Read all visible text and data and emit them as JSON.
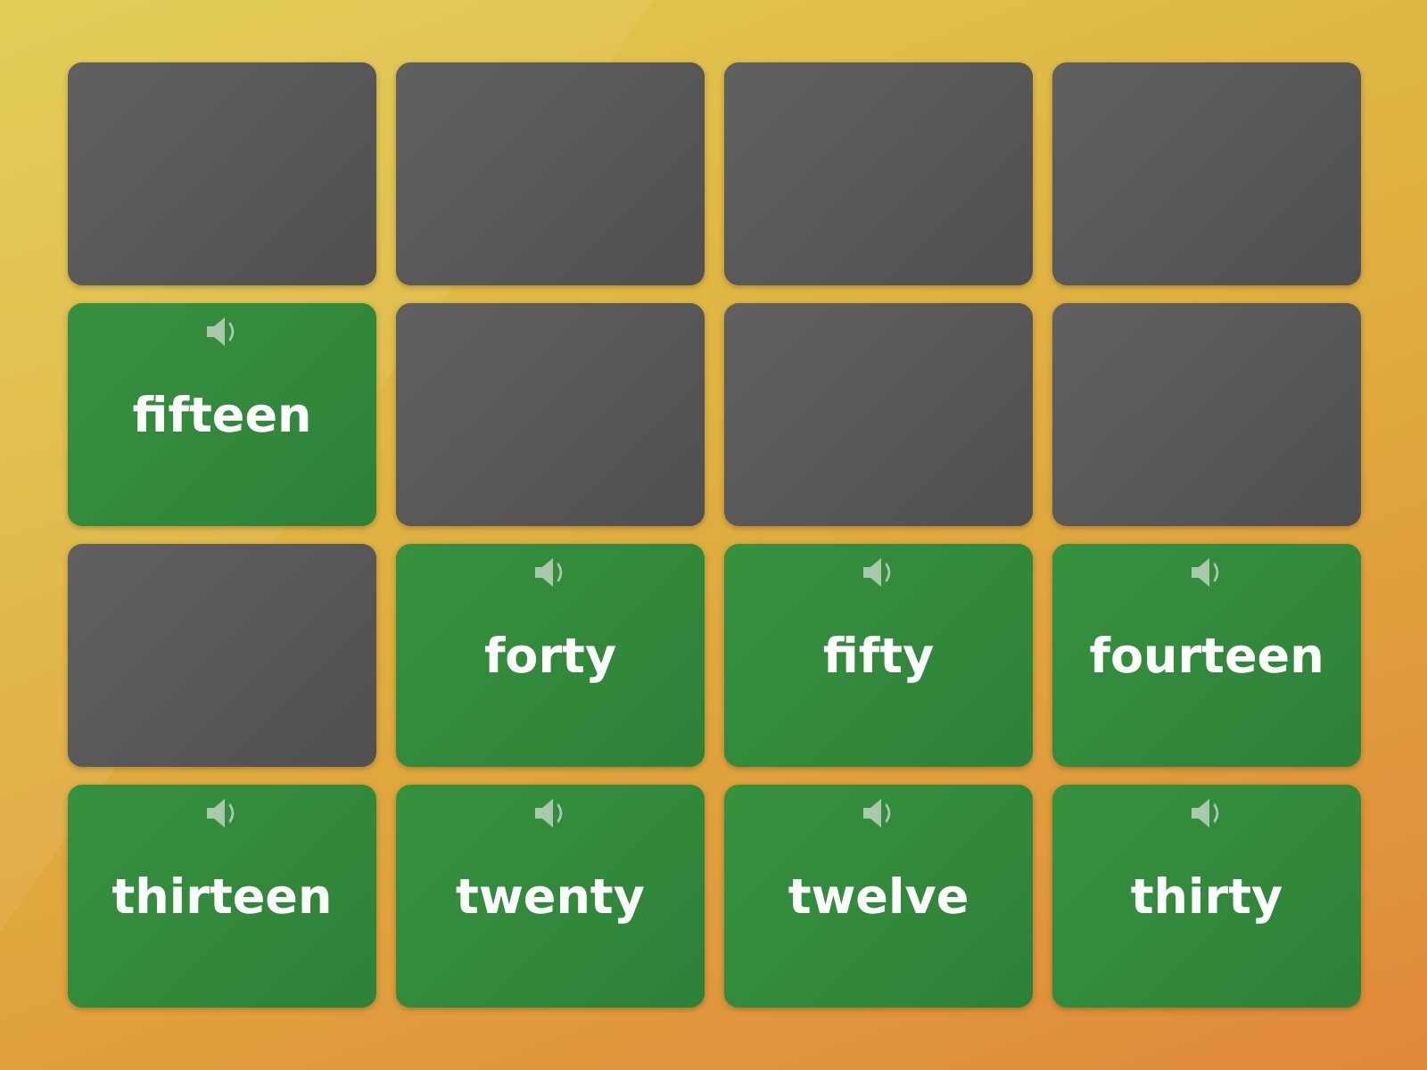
{
  "cards": [
    {
      "revealed": false
    },
    {
      "revealed": false
    },
    {
      "revealed": false
    },
    {
      "revealed": false
    },
    {
      "revealed": true,
      "word": "fifteen"
    },
    {
      "revealed": false
    },
    {
      "revealed": false
    },
    {
      "revealed": false
    },
    {
      "revealed": false
    },
    {
      "revealed": true,
      "word": "forty"
    },
    {
      "revealed": true,
      "word": "fifty"
    },
    {
      "revealed": true,
      "word": "fourteen"
    },
    {
      "revealed": true,
      "word": "thirteen"
    },
    {
      "revealed": true,
      "word": "twenty"
    },
    {
      "revealed": true,
      "word": "twelve"
    },
    {
      "revealed": true,
      "word": "thirty"
    }
  ]
}
